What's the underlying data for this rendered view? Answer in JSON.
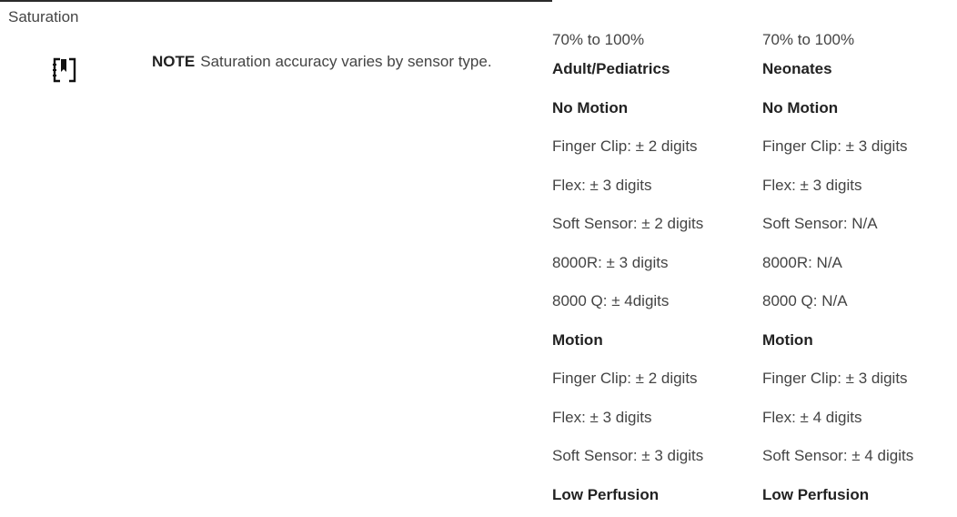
{
  "section": {
    "label": "Saturation"
  },
  "note": {
    "icon": "note-icon",
    "keyword": "NOTE",
    "text": "Saturation accuracy varies by sensor type."
  },
  "columns": {
    "adult": {
      "range": "70% to 100%",
      "heading": "Adult/Pediatrics",
      "no_motion": {
        "heading": "No Motion",
        "items": [
          "Finger Clip: ± 2 digits",
          "Flex: ± 3 digits",
          "Soft Sensor: ± 2 digits",
          "8000R: ± 3 digits",
          "8000 Q: ± 4digits"
        ]
      },
      "motion": {
        "heading": "Motion",
        "items": [
          "Finger Clip: ± 2 digits",
          "Flex: ± 3 digits",
          "Soft Sensor: ± 3 digits"
        ]
      },
      "low_perfusion": {
        "heading": "Low Perfusion"
      }
    },
    "neonates": {
      "range": "70% to 100%",
      "heading": "Neonates",
      "no_motion": {
        "heading": "No Motion",
        "items": [
          "Finger Clip: ± 3 digits",
          "Flex: ± 3 digits",
          "Soft Sensor: N/A",
          "8000R: N/A",
          "8000 Q: N/A"
        ]
      },
      "motion": {
        "heading": "Motion",
        "items": [
          "Finger Clip: ± 3 digits",
          "Flex: ± 4 digits",
          "Soft Sensor: ± 4 digits"
        ]
      },
      "low_perfusion": {
        "heading": "Low Perfusion"
      }
    }
  }
}
